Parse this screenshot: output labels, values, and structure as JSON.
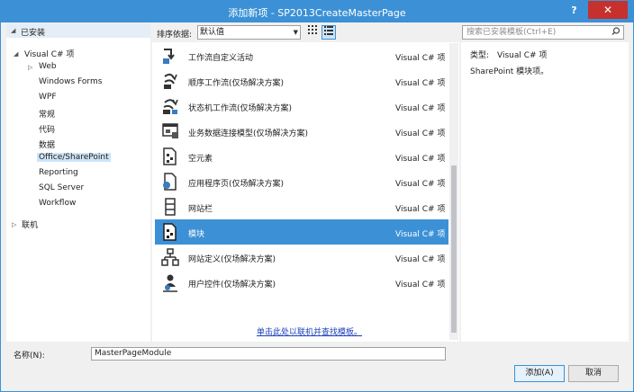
{
  "window": {
    "title": "添加新项 - SP2013CreateMasterPage",
    "help_label": "?",
    "close_label": "✕"
  },
  "tree": {
    "installed": "已安装",
    "visual_csharp": "Visual C# 项",
    "items": [
      "Web",
      "Windows Forms",
      "WPF",
      "常规",
      "代码",
      "数据",
      "Office/SharePoint",
      "Reporting",
      "SQL Server",
      "Workflow"
    ],
    "online": "联机"
  },
  "toolbar": {
    "sort_label": "排序依据:",
    "sort_value": "默认值",
    "search_placeholder": "搜索已安装模板(Ctrl+E)"
  },
  "templates": [
    {
      "name": "工作流自定义活动",
      "lang": "Visual C# 项",
      "icon": "workflow-activity-icon"
    },
    {
      "name": "顺序工作流(仅场解决方案)",
      "lang": "Visual C# 项",
      "icon": "sequential-workflow-icon"
    },
    {
      "name": "状态机工作流(仅场解决方案)",
      "lang": "Visual C# 项",
      "icon": "state-machine-workflow-icon"
    },
    {
      "name": "业务数据连接模型(仅场解决方案)",
      "lang": "Visual C# 项",
      "icon": "business-data-model-icon"
    },
    {
      "name": "空元素",
      "lang": "Visual C# 项",
      "icon": "empty-element-icon"
    },
    {
      "name": "应用程序页(仅场解决方案)",
      "lang": "Visual C# 项",
      "icon": "application-page-icon"
    },
    {
      "name": "网站栏",
      "lang": "Visual C# 项",
      "icon": "site-column-icon"
    },
    {
      "name": "模块",
      "lang": "Visual C# 项",
      "icon": "module-icon"
    },
    {
      "name": "网站定义(仅场解决方案)",
      "lang": "Visual C# 项",
      "icon": "site-definition-icon"
    },
    {
      "name": "用户控件(仅场解决方案)",
      "lang": "Visual C# 项",
      "icon": "user-control-icon"
    }
  ],
  "online_link": "单击此处以联机并查找模板。",
  "details": {
    "type_label": "类型:",
    "type_value": "Visual C# 项",
    "description": "SharePoint 模块项。"
  },
  "footer": {
    "name_label": "名称(N):",
    "name_value": "MasterPageModule",
    "add_label": "添加(A)",
    "cancel_label": "取消"
  },
  "colors": {
    "accent": "#3c91d6",
    "close": "#c7312d",
    "selection": "#cde4f7",
    "link": "#1a3fb8"
  }
}
